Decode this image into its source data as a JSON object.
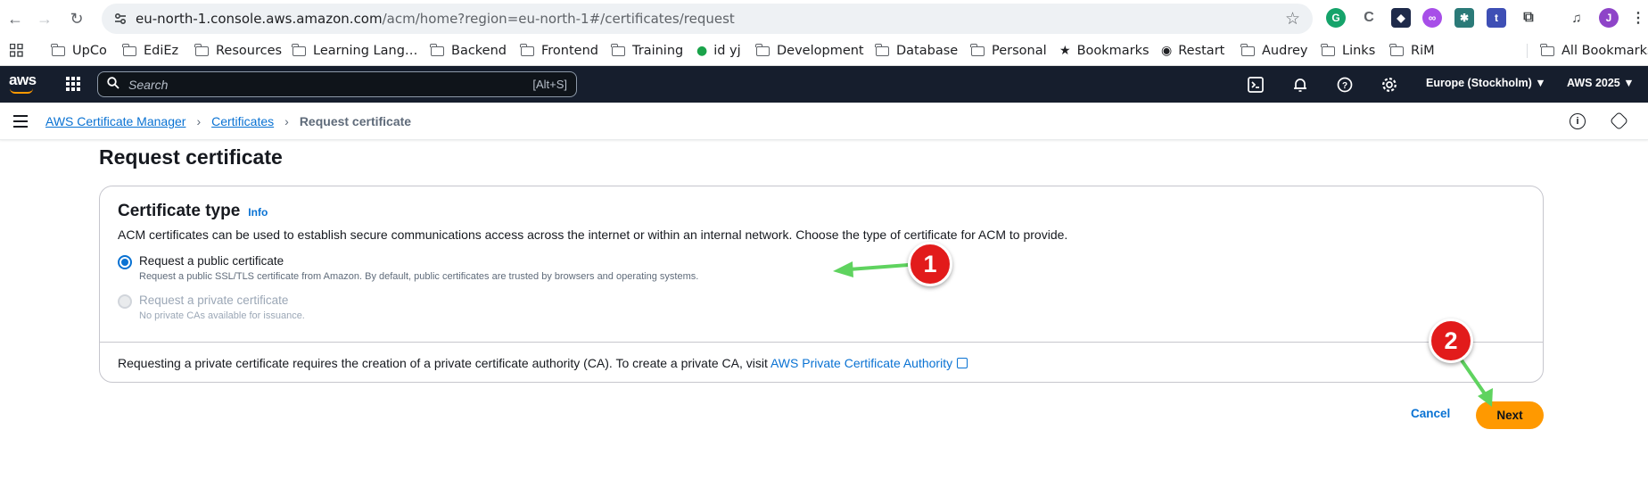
{
  "browser": {
    "url_host": "eu-north-1.console.aws.amazon.com",
    "url_path": "/acm/home?region=eu-north-1#/certificates/request",
    "bookmarks": [
      {
        "label": "UpCo",
        "type": "folder"
      },
      {
        "label": "EdiEz",
        "type": "folder"
      },
      {
        "label": "Resources",
        "type": "folder"
      },
      {
        "label": "Learning Lang…",
        "type": "folder"
      },
      {
        "label": "Backend",
        "type": "folder"
      },
      {
        "label": "Frontend",
        "type": "folder"
      },
      {
        "label": "Training",
        "type": "folder"
      },
      {
        "label": "id yj",
        "type": "site"
      },
      {
        "label": "Development",
        "type": "folder"
      },
      {
        "label": "Database",
        "type": "folder"
      },
      {
        "label": "Personal",
        "type": "folder"
      },
      {
        "label": "Bookmarks",
        "type": "star"
      },
      {
        "label": "Restart",
        "type": "globe"
      },
      {
        "label": "Audrey",
        "type": "folder"
      },
      {
        "label": "Links",
        "type": "folder"
      },
      {
        "label": "RiM",
        "type": "folder"
      }
    ],
    "all_bookmarks": "All Bookmarks",
    "profile_initial": "J"
  },
  "aws_header": {
    "logo": "aws",
    "search_placeholder": "Search",
    "search_shortcut": "[Alt+S]",
    "region": "Europe (Stockholm)",
    "account": "AWS 2025"
  },
  "breadcrumb": {
    "items": [
      "AWS Certificate Manager",
      "Certificates"
    ],
    "current": "Request certificate"
  },
  "page": {
    "title": "Request certificate",
    "panel": {
      "heading": "Certificate type",
      "info": "Info",
      "description": "ACM certificates can be used to establish secure communications access across the internet or within an internal network. Choose the type of certificate for ACM to provide.",
      "options": [
        {
          "label": "Request a public certificate",
          "sub": "Request a public SSL/TLS certificate from Amazon. By default, public certificates are trusted by browsers and operating systems.",
          "checked": true,
          "disabled": false
        },
        {
          "label": "Request a private certificate",
          "sub": "No private CAs available for issuance.",
          "checked": false,
          "disabled": true
        }
      ],
      "footer_text": "Requesting a private certificate requires the creation of a private certificate authority (CA). To create a private CA, visit ",
      "footer_link": "AWS Private Certificate Authority"
    },
    "cancel_label": "Cancel",
    "next_label": "Next"
  },
  "annotations": [
    "1",
    "2"
  ],
  "colors": {
    "accent": "#0972d3",
    "primary_button": "#ff9900",
    "annotation": "#e21b1b",
    "arrow": "#5fd35f"
  }
}
